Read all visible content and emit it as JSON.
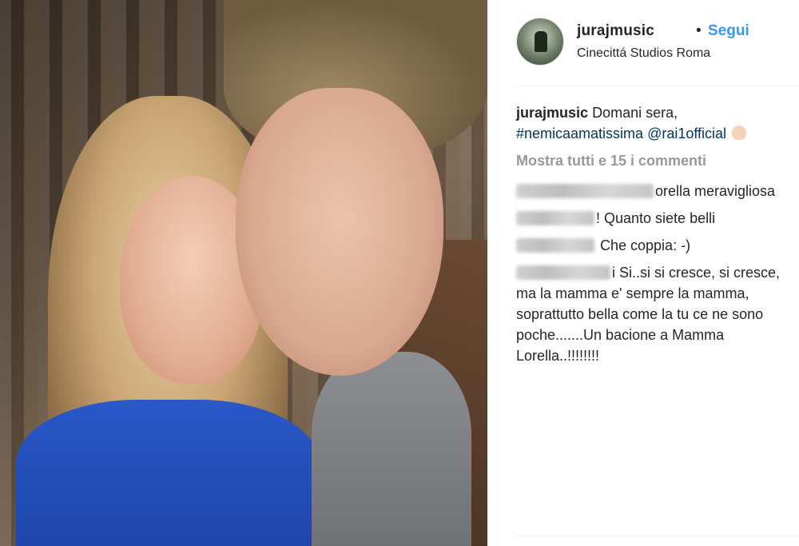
{
  "post": {
    "username": "jurajmusic",
    "separator": "•",
    "follow_label": "Segui",
    "location": "Cinecittá Studios Roma",
    "caption": {
      "username": "jurajmusic",
      "text": "Domani sera,",
      "hashtag": "#nemicaamatissima",
      "mention": "@rai1official"
    },
    "show_all_comments": "Mostra tutti e 15 i commenti",
    "comments": [
      {
        "text": "orella meravigliosa"
      },
      {
        "text": "! Quanto siete belli"
      },
      {
        "text": " Che coppia: -)"
      },
      {
        "text": "i Si..si si cresce, si cresce, ma la mamma e' sempre la mamma, soprattutto bella come la tu ce ne sono poche.......Un bacione a Mamma Lorella..!!!!!!!!"
      }
    ]
  }
}
